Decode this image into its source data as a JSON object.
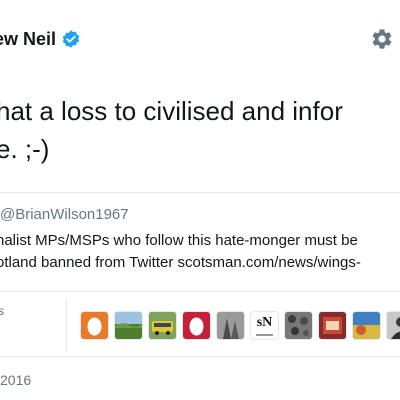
{
  "author": {
    "name_visible": "ew Neil"
  },
  "tweet": {
    "line1": "hat a loss to civilised and infor",
    "line2": "e. ;-)"
  },
  "quote": {
    "handle": "@BrianWilson1967",
    "line1": "nalist MPs/MSPs who follow this hate-monger must be",
    "line2": "otland banned from Twitter scotsman.com/news/wings-"
  },
  "stats": {
    "label_fragment": "s"
  },
  "avatars": [
    {
      "kind": "egg",
      "bg": "#e87a28"
    },
    {
      "kind": "landscape",
      "bg": "#5f8a3c"
    },
    {
      "kind": "bus",
      "bg": "#4a7a3a"
    },
    {
      "kind": "egg",
      "bg": "#c61f3a"
    },
    {
      "kind": "figure",
      "bg": "#777777"
    },
    {
      "kind": "sn-text",
      "bg": "#ffffff",
      "text": "sN"
    },
    {
      "kind": "pattern",
      "bg": "#5a5a5a"
    },
    {
      "kind": "photo",
      "bg": "#8a2b2b"
    },
    {
      "kind": "field",
      "bg": "#c9b34a"
    },
    {
      "kind": "person",
      "bg": "#6e6e6e"
    }
  ],
  "date": "2016",
  "colors": {
    "verified": "#1da1f2",
    "muted": "#657786",
    "border": "#e1e8ed",
    "text": "#14171a"
  }
}
